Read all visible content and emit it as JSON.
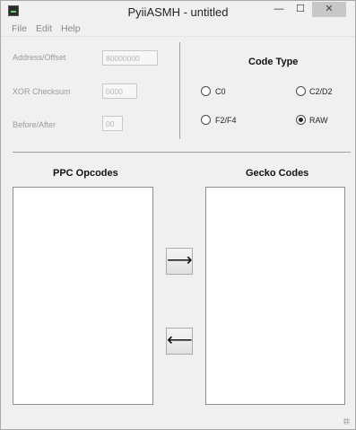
{
  "window": {
    "title": "PyiiASMH - untitled",
    "minimize_glyph": "—",
    "maximize_glyph": "☐",
    "close_glyph": "✕"
  },
  "menu": {
    "items": [
      "File",
      "Edit",
      "Help"
    ]
  },
  "fields": {
    "address": {
      "label": "Address/Offset",
      "value": "80000000"
    },
    "xor": {
      "label": "XOR Checksum",
      "value": "0000"
    },
    "before_after": {
      "label": "Before/After",
      "value": "00"
    }
  },
  "code_type": {
    "title": "Code Type",
    "options": [
      {
        "label": "C0",
        "checked": false
      },
      {
        "label": "C2/D2",
        "checked": false
      },
      {
        "label": "F2/F4",
        "checked": false
      },
      {
        "label": "RAW",
        "checked": true
      }
    ]
  },
  "panels": {
    "ppc_title": "PPC Opcodes",
    "gecko_title": "Gecko Codes"
  },
  "buttons": {
    "assemble_glyph": "⟶",
    "disassemble_glyph": "⟵"
  }
}
